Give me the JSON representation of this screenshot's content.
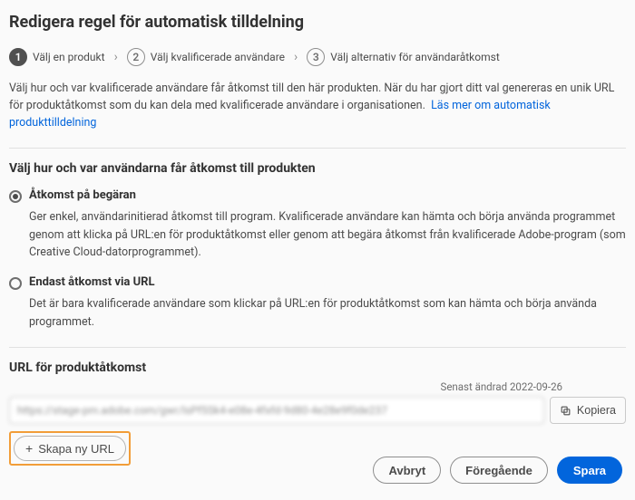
{
  "page": {
    "title": "Redigera regel för automatisk tilldelning"
  },
  "stepper": {
    "steps": [
      {
        "num": "1",
        "label": "Välj en produkt"
      },
      {
        "num": "2",
        "label": "Välj kvalificerade användare"
      },
      {
        "num": "3",
        "label": "Välj alternativ för användaråtkomst"
      }
    ]
  },
  "intro": {
    "text": "Välj hur och var kvalificerade användare får åtkomst till den här produkten. När du har gjort ditt val genereras en unik URL för produktåtkomst som du kan dela med kvalificerade användare i organisationen.",
    "link": "Läs mer om automatisk produkttilldelning"
  },
  "access_section": {
    "heading": "Välj hur och var användarna får åtkomst till produkten",
    "options": [
      {
        "label": "Åtkomst på begäran",
        "desc": "Ger enkel, användarinitierad åtkomst till program. Kvalificerade användare kan hämta och börja använda programmet genom att klicka på URL:en för produktåtkomst eller genom att begära åtkomst från kvalificerade Adobe-program (som Creative Cloud-datorprogrammet).",
        "selected": true
      },
      {
        "label": "Endast åtkomst via URL",
        "desc": "Det är bara kvalificerade användare som klickar på URL:en för produktåtkomst som kan hämta och börja använda programmet.",
        "selected": false
      }
    ]
  },
  "url_section": {
    "title": "URL för produktåtkomst",
    "last_modified_label": "Senast ändrad",
    "last_modified_date": "2022-09-26",
    "url_value": "https://stage-pm.adobe.com/gwr/lsPf5Sk4-e08e-4fxfd-9d80-4e28e9f0de237",
    "copy_label": "Kopiera",
    "create_label": "Skapa ny URL"
  },
  "footer": {
    "cancel": "Avbryt",
    "prev": "Föregående",
    "save": "Spara"
  }
}
